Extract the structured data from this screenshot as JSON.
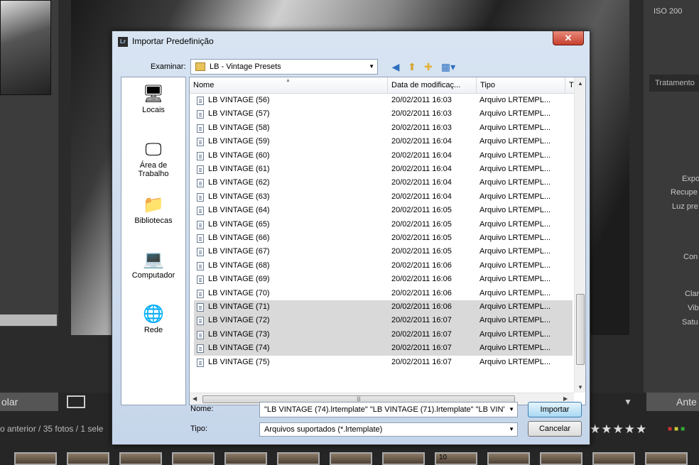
{
  "background": {
    "right_panel": {
      "iso": "ISO 200",
      "section": "Tratamento",
      "labels": [
        "Expo",
        "Recupe",
        "Luz pre",
        "Con",
        "Clar",
        "Vib",
        "Satu"
      ]
    },
    "bottom": {
      "left_button": "olar",
      "right_button": "Ante",
      "status": "o anterior / 35 fotos / 1 sele",
      "stars": "★★★★★",
      "film_badge": "10"
    }
  },
  "dialog": {
    "title": "Importar Predefinição",
    "close_label": "✕",
    "examine_label": "Examinar:",
    "current_folder": "LB - Vintage Presets",
    "places": [
      {
        "label": "Locais",
        "icon": "recent-places-icon"
      },
      {
        "label": "Área de Trabalho",
        "icon": "desktop-icon"
      },
      {
        "label": "Bibliotecas",
        "icon": "libraries-icon"
      },
      {
        "label": "Computador",
        "icon": "computer-icon"
      },
      {
        "label": "Rede",
        "icon": "network-icon"
      }
    ],
    "columns": [
      "Nome",
      "Data de modificaç...",
      "Tipo",
      "T"
    ],
    "files": [
      {
        "name": "LB VINTAGE (56)",
        "date": "20/02/2011 16:03",
        "type": "Arquivo LRTEMPL...",
        "selected": false
      },
      {
        "name": "LB VINTAGE (57)",
        "date": "20/02/2011 16:03",
        "type": "Arquivo LRTEMPL...",
        "selected": false
      },
      {
        "name": "LB VINTAGE (58)",
        "date": "20/02/2011 16:03",
        "type": "Arquivo LRTEMPL...",
        "selected": false
      },
      {
        "name": "LB VINTAGE (59)",
        "date": "20/02/2011 16:04",
        "type": "Arquivo LRTEMPL...",
        "selected": false
      },
      {
        "name": "LB VINTAGE (60)",
        "date": "20/02/2011 16:04",
        "type": "Arquivo LRTEMPL...",
        "selected": false
      },
      {
        "name": "LB VINTAGE (61)",
        "date": "20/02/2011 16:04",
        "type": "Arquivo LRTEMPL...",
        "selected": false
      },
      {
        "name": "LB VINTAGE (62)",
        "date": "20/02/2011 16:04",
        "type": "Arquivo LRTEMPL...",
        "selected": false
      },
      {
        "name": "LB VINTAGE (63)",
        "date": "20/02/2011 16:04",
        "type": "Arquivo LRTEMPL...",
        "selected": false
      },
      {
        "name": "LB VINTAGE (64)",
        "date": "20/02/2011 16:05",
        "type": "Arquivo LRTEMPL...",
        "selected": false
      },
      {
        "name": "LB VINTAGE (65)",
        "date": "20/02/2011 16:05",
        "type": "Arquivo LRTEMPL...",
        "selected": false
      },
      {
        "name": "LB VINTAGE (66)",
        "date": "20/02/2011 16:05",
        "type": "Arquivo LRTEMPL...",
        "selected": false
      },
      {
        "name": "LB VINTAGE (67)",
        "date": "20/02/2011 16:05",
        "type": "Arquivo LRTEMPL...",
        "selected": false
      },
      {
        "name": "LB VINTAGE (68)",
        "date": "20/02/2011 16:06",
        "type": "Arquivo LRTEMPL...",
        "selected": false
      },
      {
        "name": "LB VINTAGE (69)",
        "date": "20/02/2011 16:06",
        "type": "Arquivo LRTEMPL...",
        "selected": false
      },
      {
        "name": "LB VINTAGE (70)",
        "date": "20/02/2011 16:06",
        "type": "Arquivo LRTEMPL...",
        "selected": false
      },
      {
        "name": "LB VINTAGE (71)",
        "date": "20/02/2011 16:06",
        "type": "Arquivo LRTEMPL...",
        "selected": true
      },
      {
        "name": "LB VINTAGE (72)",
        "date": "20/02/2011 16:07",
        "type": "Arquivo LRTEMPL...",
        "selected": true
      },
      {
        "name": "LB VINTAGE (73)",
        "date": "20/02/2011 16:07",
        "type": "Arquivo LRTEMPL...",
        "selected": true
      },
      {
        "name": "LB VINTAGE (74)",
        "date": "20/02/2011 16:07",
        "type": "Arquivo LRTEMPL...",
        "selected": true
      },
      {
        "name": "LB VINTAGE (75)",
        "date": "20/02/2011 16:07",
        "type": "Arquivo LRTEMPL...",
        "selected": false
      }
    ],
    "name_label": "Nome:",
    "name_value": "\"LB VINTAGE (74).lrtemplate\" \"LB VINTAGE (71).lrtemplate\" \"LB VIN'",
    "type_label": "Tipo:",
    "type_value": "Arquivos suportados (*.lrtemplate)",
    "import_button": "Importar",
    "cancel_button": "Cancelar"
  }
}
